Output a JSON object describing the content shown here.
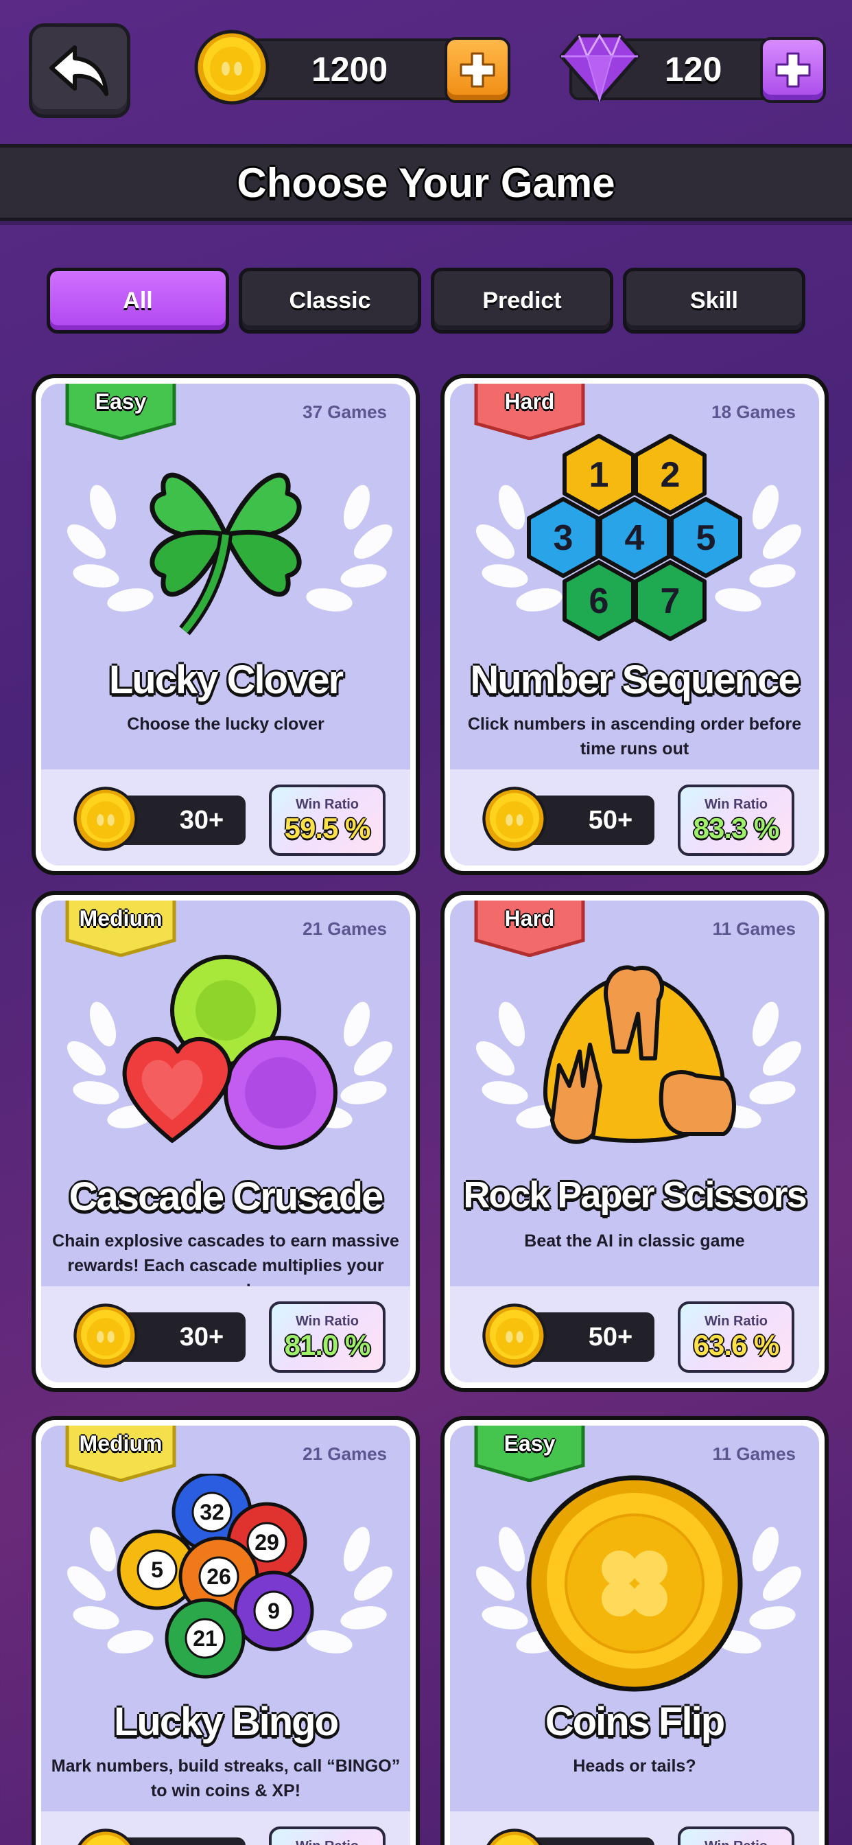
{
  "header": {
    "coins": "1200",
    "gems": "120",
    "title": "Choose Your Game"
  },
  "tabs": [
    {
      "label": "All",
      "active": true
    },
    {
      "label": "Classic",
      "active": false
    },
    {
      "label": "Predict",
      "active": false
    },
    {
      "label": "Skill",
      "active": false
    }
  ],
  "colors": {
    "easy": "#46c54e",
    "medium": "#f4e04a",
    "hard": "#f26a6a",
    "win_yellow": "#ffe24a",
    "win_green": "#9ff06a",
    "accent_purple": "#c05cf6"
  },
  "games": [
    {
      "difficulty": "Easy",
      "games_count": "37 Games",
      "title": "Lucky Clover",
      "description": "Choose the lucky clover",
      "entry_fee": "30+",
      "win_ratio_label": "Win Ratio",
      "win_ratio": "59.5 %",
      "icon": "four-leaf-clover-icon"
    },
    {
      "difficulty": "Hard",
      "games_count": "18 Games",
      "title": "Number Sequence",
      "description": "Click numbers in ascending order before time runs out",
      "entry_fee": "50+",
      "win_ratio_label": "Win Ratio",
      "win_ratio": "83.3 %",
      "icon": "number-hexagons-icon",
      "numbers": [
        "1",
        "2",
        "3",
        "4",
        "5",
        "6",
        "7"
      ]
    },
    {
      "difficulty": "Medium",
      "games_count": "21 Games",
      "title": "Cascade Crusade",
      "description": "Chain explosive cascades to earn massive rewards! Each cascade multiplies your score!",
      "entry_fee": "30+",
      "win_ratio_label": "Win Ratio",
      "win_ratio": "81.0 %",
      "icon": "candy-gems-icon"
    },
    {
      "difficulty": "Hard",
      "games_count": "11 Games",
      "title": "Rock Paper Scissors",
      "description": "Beat the AI in classic game",
      "entry_fee": "50+",
      "win_ratio_label": "Win Ratio",
      "win_ratio": "63.6 %",
      "icon": "hand-gestures-icon"
    },
    {
      "difficulty": "Medium",
      "games_count": "21 Games",
      "title": "Lucky Bingo",
      "description": "Mark numbers, build streaks, call “BINGO” to win coins & XP!",
      "entry_fee": "",
      "win_ratio_label": "Win Ratio",
      "win_ratio": "",
      "icon": "bingo-balls-icon",
      "balls": [
        "32",
        "29",
        "5",
        "26",
        "9",
        "21"
      ]
    },
    {
      "difficulty": "Easy",
      "games_count": "11 Games",
      "title": "Coins Flip",
      "description": "Heads or tails?",
      "entry_fee": "",
      "win_ratio_label": "Win Ratio",
      "win_ratio": "",
      "icon": "gold-coin-icon"
    }
  ]
}
